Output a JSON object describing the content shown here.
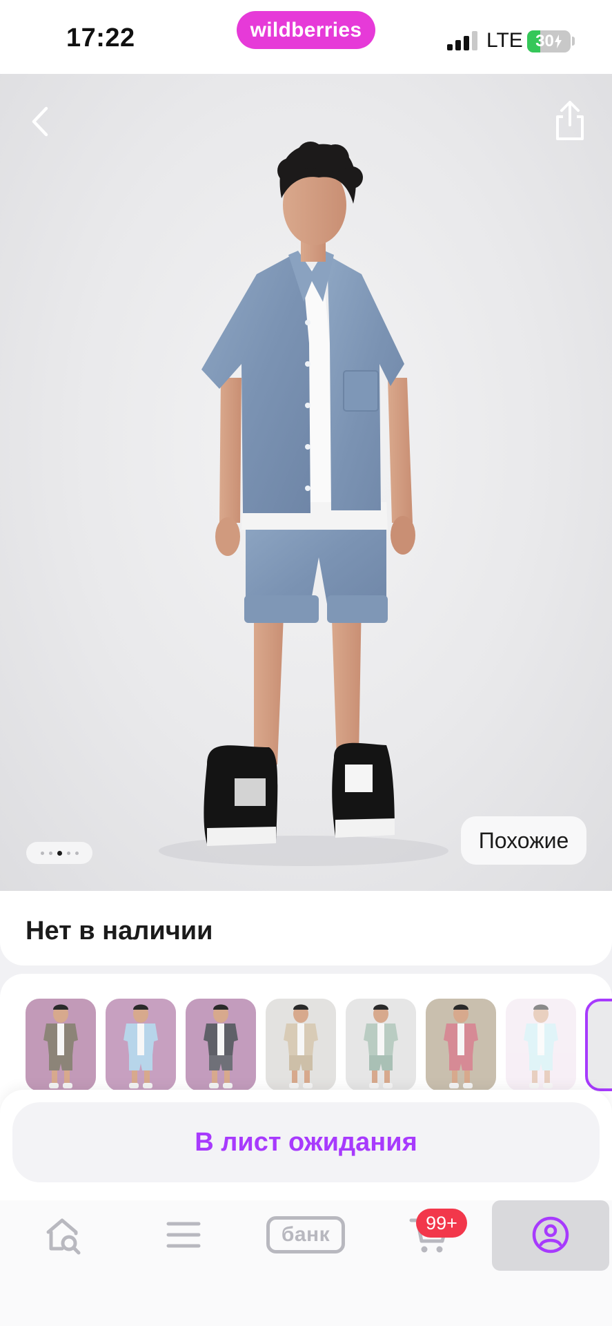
{
  "status_bar": {
    "time": "17:22",
    "brand": "wildberries",
    "network": "LTE",
    "battery_level": "30",
    "battery_fraction": 0.3
  },
  "colors": {
    "brand": "#e63ad8",
    "accent": "#a73afd",
    "badge": "#f2374b",
    "nav_icon": "#b8b8bf"
  },
  "hero": {
    "back_icon": "chevron-left-icon",
    "share_icon": "share-icon",
    "pagination": {
      "count": 5,
      "active_index": 2
    },
    "similar_label": "Похожие"
  },
  "product": {
    "availability": "Нет в наличии"
  },
  "variants": [
    {
      "bg": "#c29ab8",
      "shirt": "#8c8478",
      "shorts": "#8c8478"
    },
    {
      "bg": "#c7a0c0",
      "shirt": "#b7d5ea",
      "shorts": "#b7d5ea"
    },
    {
      "bg": "#c39cbd",
      "shirt": "#5f6068",
      "shorts": "#6f7078"
    },
    {
      "bg": "#e3e2e0",
      "shirt": "#d8cbb6",
      "shorts": "#cdbfa8"
    },
    {
      "bg": "#e6e6e6",
      "shirt": "#b9ccc2",
      "shorts": "#a9c0b5"
    },
    {
      "bg": "#c9bfae",
      "shirt": "#d68a95",
      "shorts": "#d68a95"
    },
    {
      "bg": "#f1e3ef",
      "shirt": "#c7ecf2",
      "shorts": "#c7ecf2"
    }
  ],
  "actions": {
    "waitlist_label": "В лист ожидания"
  },
  "bottom_nav": {
    "items": [
      {
        "name": "home-search",
        "icon": "home-search-icon"
      },
      {
        "name": "catalog",
        "icon": "menu-icon"
      },
      {
        "name": "bank",
        "label": "банк"
      },
      {
        "name": "cart",
        "icon": "cart-icon",
        "badge": "99+"
      },
      {
        "name": "profile",
        "icon": "profile-icon"
      }
    ]
  }
}
